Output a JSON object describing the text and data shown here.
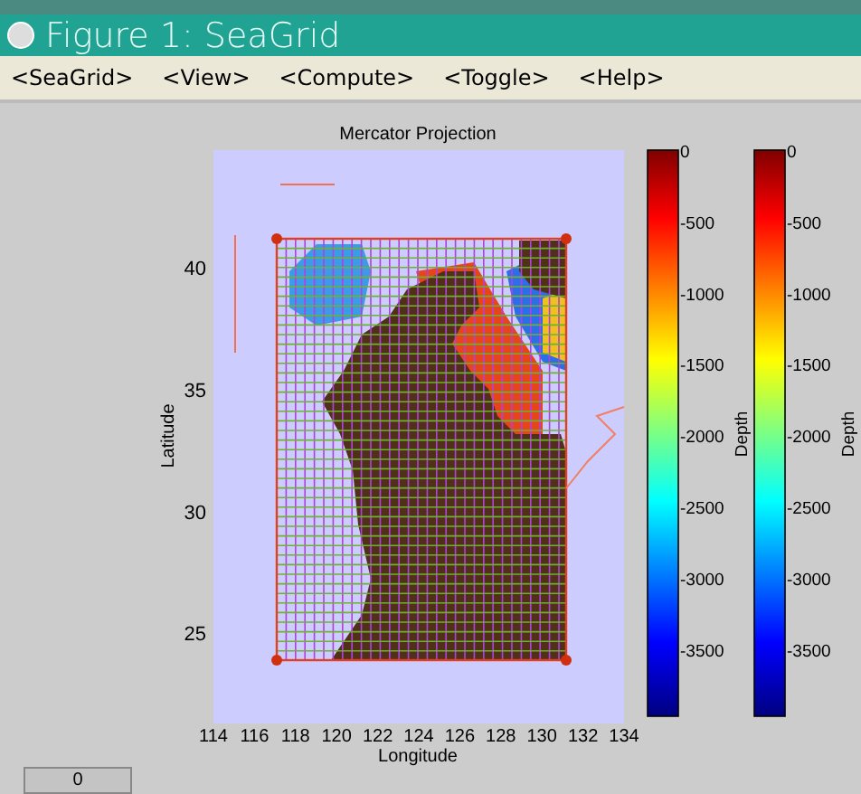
{
  "window": {
    "title": "Figure 1: SeaGrid"
  },
  "menu": [
    "<SeaGrid>",
    "<View>",
    "<Compute>",
    "<Toggle>",
    "<Help>"
  ],
  "plot": {
    "title": "Mercator Projection",
    "xlabel": "Longitude",
    "ylabel": "Latitude",
    "xticks": [
      "114",
      "116",
      "118",
      "120",
      "122",
      "124",
      "126",
      "128",
      "130",
      "132",
      "134"
    ],
    "yticks": [
      "40",
      "35",
      "30",
      "25"
    ]
  },
  "colorbars": [
    {
      "label": "Depth",
      "ticks": [
        "0",
        "-500",
        "-1000",
        "-1500",
        "-2000",
        "-2500",
        "-3000",
        "-3500"
      ]
    },
    {
      "label": "Depth",
      "ticks": [
        "0",
        "-500",
        "-1000",
        "-1500",
        "-2000",
        "-2500",
        "-3000",
        "-3500"
      ]
    }
  ],
  "status_field": {
    "value": "0"
  }
}
